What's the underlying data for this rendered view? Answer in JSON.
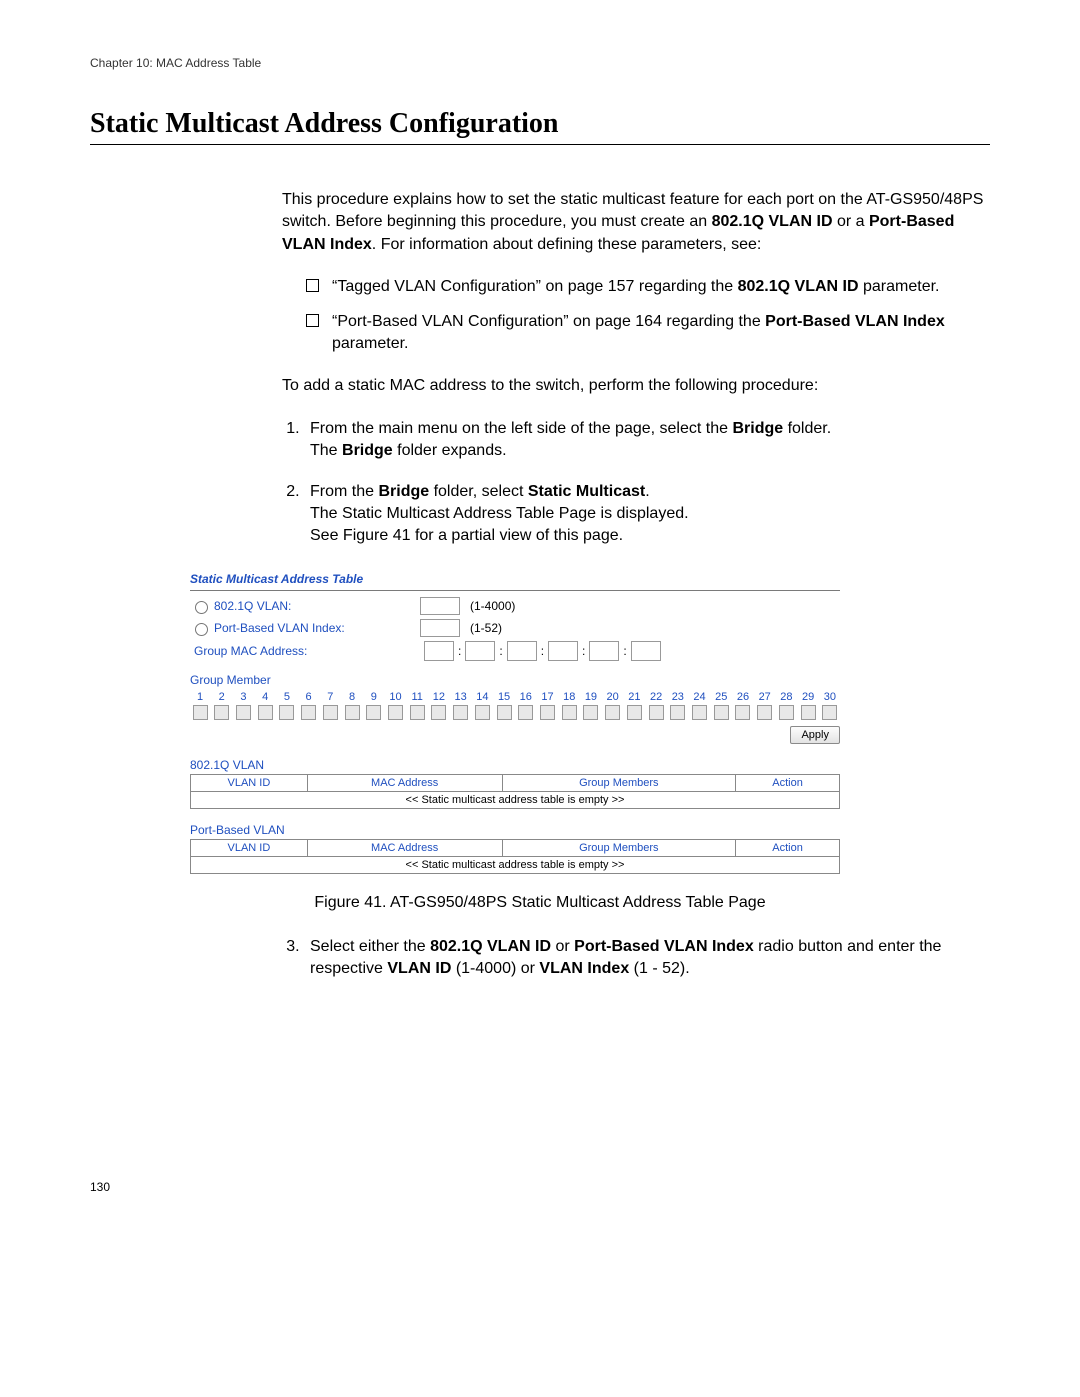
{
  "chapter_header": "Chapter 10: MAC Address Table",
  "title": "Static Multicast Address Configuration",
  "intro_pre": "This procedure explains how to set the static multicast feature for each port on the AT-GS950/48PS switch. Before beginning this procedure, you must create an ",
  "intro_b1": "802.1Q VLAN ID",
  "intro_mid": " or a ",
  "intro_b2": "Port-Based VLAN Index",
  "intro_post": ". For information about defining these parameters, see:",
  "bullet1_pre": "“Tagged VLAN Configuration” on page 157 regarding the ",
  "bullet1_b": "802.1Q VLAN ID",
  "bullet1_post": " parameter.",
  "bullet2_pre": "“Port-Based VLAN Configuration” on page 164 regarding the ",
  "bullet2_b": "Port-Based VLAN Index",
  "bullet2_post": " parameter.",
  "lead2": "To add a static MAC address to the switch, perform the following procedure:",
  "step1_pre": "From the main menu on the left side of the page, select the ",
  "step1_b": "Bridge",
  "step1_post": " folder.",
  "step1_l2a": "The ",
  "step1_l2b": "Bridge",
  "step1_l2c": " folder expands.",
  "step2_pre": "From the ",
  "step2_b1": "Bridge",
  "step2_mid": " folder, select ",
  "step2_b2": "Static Multicast",
  "step2_post": ".",
  "step2_l2": "The Static Multicast Address Table Page is displayed.",
  "step2_l3": "See Figure 41 for a partial view of this page.",
  "shot": {
    "panel_title": "Static Multicast Address Table",
    "radio1": "802.1Q VLAN:",
    "range1": "(1-4000)",
    "radio2": "Port-Based VLAN Index:",
    "range2": "(1-52)",
    "gmac": "Group MAC Address:",
    "gmember": "Group Member",
    "ports": [
      "1",
      "2",
      "3",
      "4",
      "5",
      "6",
      "7",
      "8",
      "9",
      "10",
      "11",
      "12",
      "13",
      "14",
      "15",
      "16",
      "17",
      "18",
      "19",
      "20",
      "21",
      "22",
      "23",
      "24",
      "25",
      "26",
      "27",
      "28",
      "29",
      "30"
    ],
    "apply": "Apply",
    "sec1": "802.1Q VLAN",
    "sec2": "Port-Based VLAN",
    "th_vlan": "VLAN ID",
    "th_mac": "MAC Address",
    "th_gm": "Group Members",
    "th_act": "Action",
    "empty": "<< Static multicast address table is empty >>"
  },
  "figure_caption": "Figure 41. AT-GS950/48PS Static Multicast Address Table Page",
  "step3_pre": "Select either the ",
  "step3_b1": "802.1Q VLAN ID",
  "step3_mid1": " or ",
  "step3_b2": "Port-Based VLAN Index",
  "step3_mid2": " radio button and enter the respective ",
  "step3_b3": "VLAN ID",
  "step3_mid3": " (1-4000) or ",
  "step3_b4": "VLAN Index",
  "step3_post": " (1 - 52).",
  "page_number": "130"
}
